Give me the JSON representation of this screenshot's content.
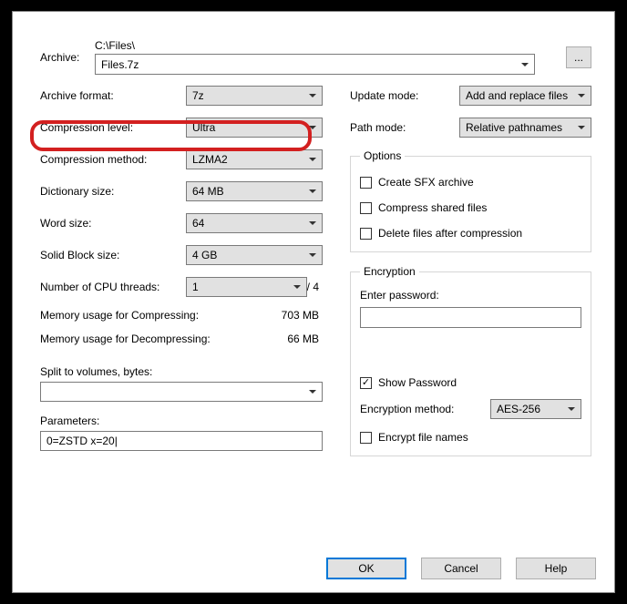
{
  "archive": {
    "label": "Archive:",
    "path": "C:\\Files\\",
    "filename": "Files.7z",
    "browse": "..."
  },
  "left": {
    "format_label": "Archive format:",
    "format_value": "7z",
    "level_label": "Compression level:",
    "level_value": "Ultra",
    "method_label": "Compression method:",
    "method_value": "LZMA2",
    "dict_label": "Dictionary size:",
    "dict_value": "64 MB",
    "word_label": "Word size:",
    "word_value": "64",
    "block_label": "Solid Block size:",
    "block_value": "4 GB",
    "threads_label": "Number of CPU threads:",
    "threads_value": "1",
    "threads_total": "/ 4",
    "mem_comp_label": "Memory usage for Compressing:",
    "mem_comp_value": "703 MB",
    "mem_decomp_label": "Memory usage for Decompressing:",
    "mem_decomp_value": "66 MB",
    "split_label": "Split to volumes, bytes:",
    "params_label": "Parameters:",
    "params_value": "0=ZSTD x=20|"
  },
  "right": {
    "update_label": "Update mode:",
    "update_value": "Add and replace files",
    "path_label": "Path mode:",
    "path_value": "Relative pathnames",
    "options_legend": "Options",
    "opt_sfx": "Create SFX archive",
    "opt_shared": "Compress shared files",
    "opt_delete": "Delete files after compression",
    "enc_legend": "Encryption",
    "enter_pass": "Enter password:",
    "show_pass": "Show Password",
    "enc_method_label": "Encryption method:",
    "enc_method_value": "AES-256",
    "enc_names": "Encrypt file names"
  },
  "buttons": {
    "ok": "OK",
    "cancel": "Cancel",
    "help": "Help"
  }
}
